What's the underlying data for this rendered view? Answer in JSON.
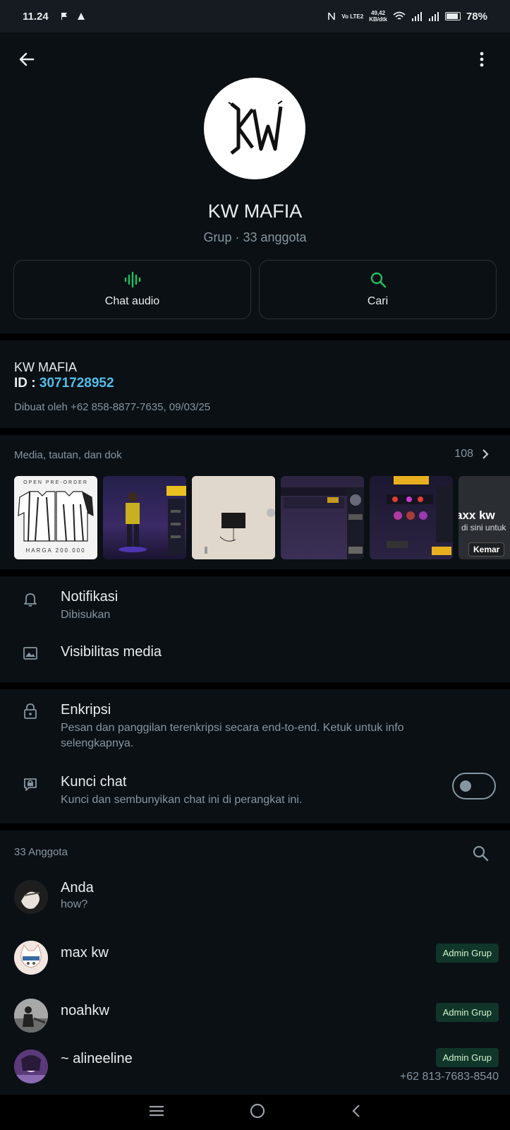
{
  "status_bar": {
    "time": "11.24",
    "net_speed_value": "49,42",
    "net_speed_unit": "KB/dtk",
    "lte_label": "Vo LTE2",
    "battery": "78%"
  },
  "header": {
    "group_name": "KW MAFIA",
    "group_subtitle": "Grup · 33 anggota",
    "avatar_text": "KW",
    "actions": [
      {
        "label": "Chat audio",
        "icon": "audio-wave-icon"
      },
      {
        "label": "Cari",
        "icon": "search-icon"
      }
    ]
  },
  "info": {
    "name": "KW MAFIA",
    "id_label": "ID : ",
    "id_value": "3071728952",
    "created": "Dibuat oleh +62 858-8877-7635, 09/03/25"
  },
  "media": {
    "title": "Media, tautan, dan dok",
    "count": "108",
    "thumbs": [
      {
        "kind": "jersey",
        "top_text": "OPEN PRE-ORDER",
        "bottom_text": "HARGA 200.000"
      },
      {
        "kind": "game-character"
      },
      {
        "kind": "photo-room"
      },
      {
        "kind": "game-screen"
      },
      {
        "kind": "game-menu"
      },
      {
        "kind": "message-preview",
        "line1": "axx kw",
        "line2": "di sini untuk",
        "button": "Kemar"
      }
    ]
  },
  "settings": {
    "notifications_title": "Notifikasi",
    "notifications_sub": "Dibisukan",
    "media_visibility": "Visibilitas media",
    "encryption_title": "Enkripsi",
    "encryption_sub": "Pesan dan panggilan terenkripsi secara end-to-end. Ketuk untuk info selengkapnya.",
    "chat_lock_title": "Kunci chat",
    "chat_lock_sub": "Kunci dan sembunyikan chat ini di perangkat ini.",
    "chat_lock_enabled": false
  },
  "members": {
    "title": "33 Anggota",
    "list": [
      {
        "name": "Anda",
        "status": "how?",
        "badge": "",
        "phone": ""
      },
      {
        "name": "max kw",
        "status": "",
        "badge": "Admin Grup",
        "phone": ""
      },
      {
        "name": "noahkw",
        "status": "",
        "badge": "Admin Grup",
        "phone": ""
      },
      {
        "name": "~ alineeline",
        "status": "",
        "badge": "Admin Grup",
        "phone": "+62 813-7683-8540"
      }
    ]
  },
  "colors": {
    "background": "#0b1014",
    "accent_green": "#21c063",
    "link_blue": "#53bdeb",
    "muted_text": "#8696a0"
  }
}
